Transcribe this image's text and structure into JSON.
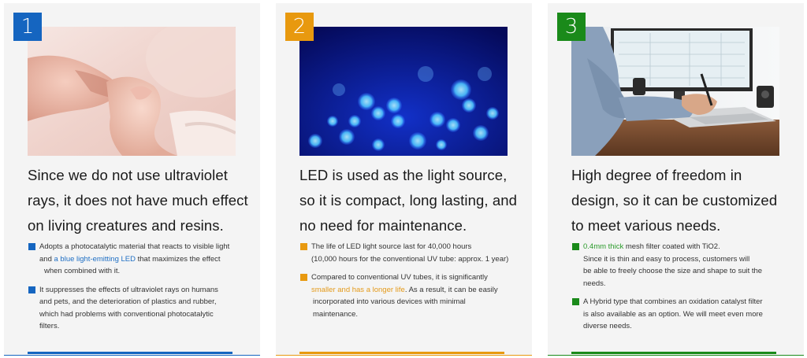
{
  "colors": {
    "blue": "#1565c0",
    "orange": "#e8990f",
    "green": "#1a8a1a"
  },
  "cards": [
    {
      "number": "1",
      "image": "baby-hand-photo",
      "headline": [
        "Since we do not use ultraviolet",
        "rays, it does not have much effect",
        "on living creatures and resins."
      ],
      "bullets": [
        {
          "lines": [
            [
              "Adopts a photocatalytic material that reacts to visible light"
            ],
            [
              "and ",
              "a blue light-emitting LED",
              " that maximizes the effect"
            ],
            [
              "when combined with it."
            ]
          ]
        },
        {
          "lines": [
            [
              "It suppresses the effects of ultraviolet rays on humans"
            ],
            [
              "and pets, and the deterioration of plastics and rubber,"
            ],
            [
              "which had problems with conventional photocatalytic"
            ],
            [
              "filters."
            ]
          ]
        }
      ]
    },
    {
      "number": "2",
      "image": "blue-led-bokeh-photo",
      "headline": [
        "LED is used as the light source,",
        "so it is compact, long lasting, and",
        "no need for maintenance."
      ],
      "bullets": [
        {
          "lines": [
            [
              "The life of LED light source last for 40,000 hours"
            ],
            [
              "(10,000 hours for the conventional UV tube: approx. 1 year)"
            ]
          ]
        },
        {
          "lines": [
            [
              "Compared to conventional UV tubes, it is significantly"
            ],
            [
              "",
              "smaller and has a longer life",
              ". As a result, it can be easily"
            ],
            [
              "incorporated into various devices with minimal"
            ],
            [
              "maintenance."
            ]
          ]
        }
      ]
    },
    {
      "number": "3",
      "image": "designer-at-desk-photo",
      "headline": [
        "High degree of freedom in",
        "design, so it can be customized",
        "to meet various needs."
      ],
      "bullets": [
        {
          "lines": [
            [
              "",
              "0.4mm thick",
              " mesh filter coated with TiO2."
            ],
            [
              "Since it is thin and easy to process, customers will"
            ],
            [
              "be able to freely choose the size and shape to suit the"
            ],
            [
              "needs."
            ]
          ]
        },
        {
          "lines": [
            [
              "A Hybrid type that combines an oxidation catalyst filter"
            ],
            [
              "is also available as an option. We will meet even more"
            ],
            [
              "diverse needs."
            ]
          ]
        }
      ]
    }
  ]
}
